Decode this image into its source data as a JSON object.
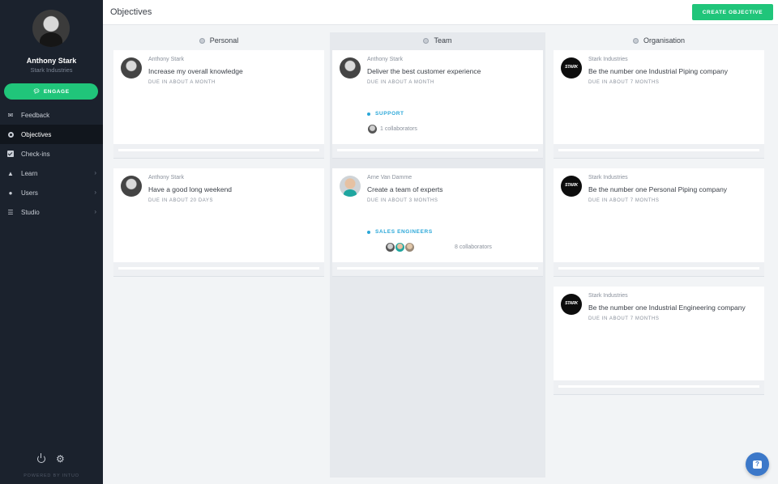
{
  "user": {
    "name": "Anthony Stark",
    "company": "Stark Industries"
  },
  "sidebar": {
    "engage_label": "ENGAGE",
    "items": [
      {
        "label": "Feedback",
        "icon": "chat-icon",
        "active": false,
        "chevron": false
      },
      {
        "label": "Objectives",
        "icon": "target-icon",
        "active": true,
        "chevron": false
      },
      {
        "label": "Check-ins",
        "icon": "checkbox-icon",
        "active": false,
        "chevron": false
      },
      {
        "label": "Learn",
        "icon": "graduation-cap-icon",
        "active": false,
        "chevron": true
      },
      {
        "label": "Users",
        "icon": "users-icon",
        "active": false,
        "chevron": true
      },
      {
        "label": "Studio",
        "icon": "sliders-icon",
        "active": false,
        "chevron": true
      }
    ],
    "powered_by": "POWERED BY INTUO"
  },
  "header": {
    "title": "Objectives",
    "create_label": "CREATE OBJECTIVE"
  },
  "columns": {
    "personal": {
      "title": "Personal",
      "cards": [
        {
          "owner": "Anthony Stark",
          "title": "Increase my overall knowledge",
          "due": "DUE IN ABOUT A MONTH"
        },
        {
          "owner": "Anthony Stark",
          "title": "Have a good long weekend",
          "due": "DUE IN ABOUT 20 DAYS"
        }
      ]
    },
    "team": {
      "title": "Team",
      "cards": [
        {
          "owner": "Anthony Stark",
          "title": "Deliver the best customer experience",
          "due": "DUE IN ABOUT A MONTH",
          "tag": "SUPPORT",
          "collaborators": "1 collaborators"
        },
        {
          "owner": "Arne Van Damme",
          "title": "Create a team of experts",
          "due": "DUE IN ABOUT 3 MONTHS",
          "tag": "SALES ENGINEERS",
          "collaborators": "8 collaborators"
        }
      ]
    },
    "organisation": {
      "title": "Organisation",
      "cards": [
        {
          "owner": "Stark Industries",
          "title": "Be the number one Industrial Piping company",
          "due": "DUE IN ABOUT 7 MONTHS"
        },
        {
          "owner": "Stark Industries",
          "title": "Be the number one Personal Piping company",
          "due": "DUE IN ABOUT 7 MONTHS"
        },
        {
          "owner": "Stark Industries",
          "title": "Be the number one Industrial Engineering company",
          "due": "DUE IN ABOUT 7 MONTHS"
        }
      ]
    }
  },
  "colors": {
    "accent": "#20c57a",
    "sidebar": "#1b222d",
    "tag": "#2aa7d8",
    "help": "#3c78c9"
  }
}
